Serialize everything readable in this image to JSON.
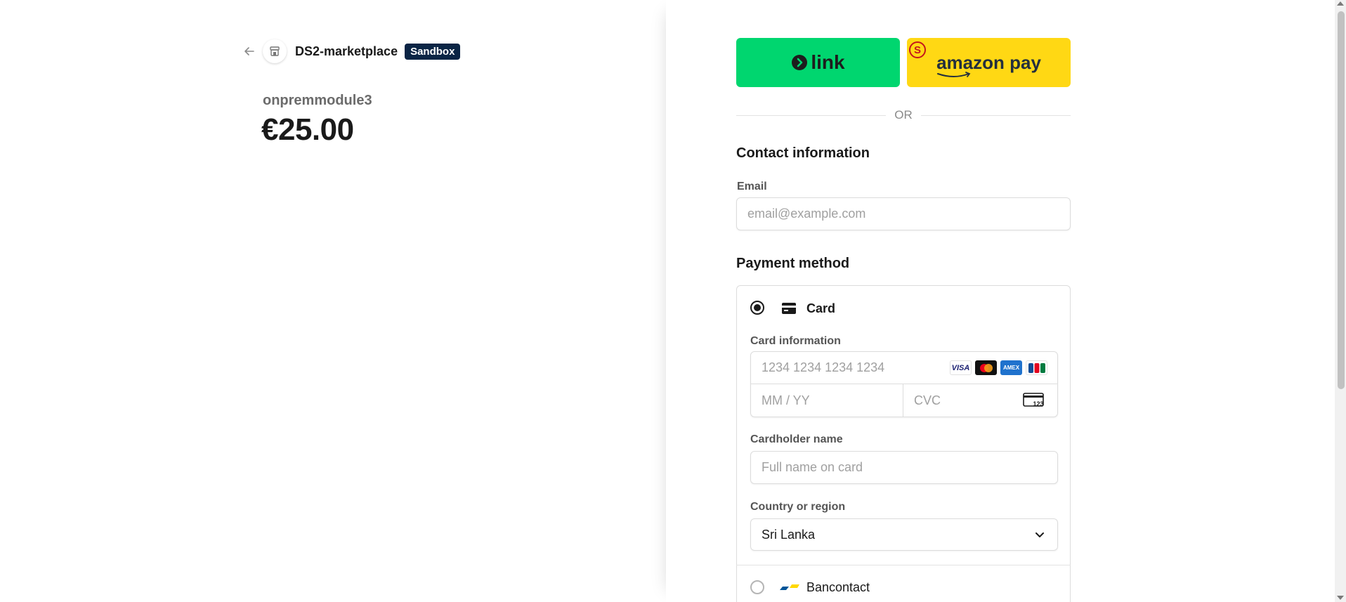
{
  "merchant": {
    "name": "DS2-marketplace",
    "badge": "Sandbox"
  },
  "product": {
    "name": "onpremmodule3",
    "price": "€25.00"
  },
  "wallets": {
    "link_label": "link",
    "amazon_label": "amazon pay"
  },
  "divider": {
    "or": "OR"
  },
  "contact": {
    "title": "Contact information",
    "email_label": "Email",
    "email_placeholder": "email@example.com"
  },
  "payment": {
    "title": "Payment method",
    "card_option": "Card",
    "card_info_label": "Card information",
    "card_number_placeholder": "1234 1234 1234 1234",
    "expiry_placeholder": "MM / YY",
    "cvc_placeholder": "CVC",
    "cvc_icon_text": "123",
    "brands": [
      "VISA",
      "Mastercard",
      "AMEX",
      "JCB"
    ],
    "cardholder_label": "Cardholder name",
    "cardholder_placeholder": "Full name on card",
    "country_label": "Country or region",
    "country_value": "Sri Lanka",
    "bancontact_option": "Bancontact"
  },
  "colors": {
    "link_green": "#00d66f",
    "amazon_yellow": "#ffd814",
    "sandbox_bg": "#0b2545"
  }
}
